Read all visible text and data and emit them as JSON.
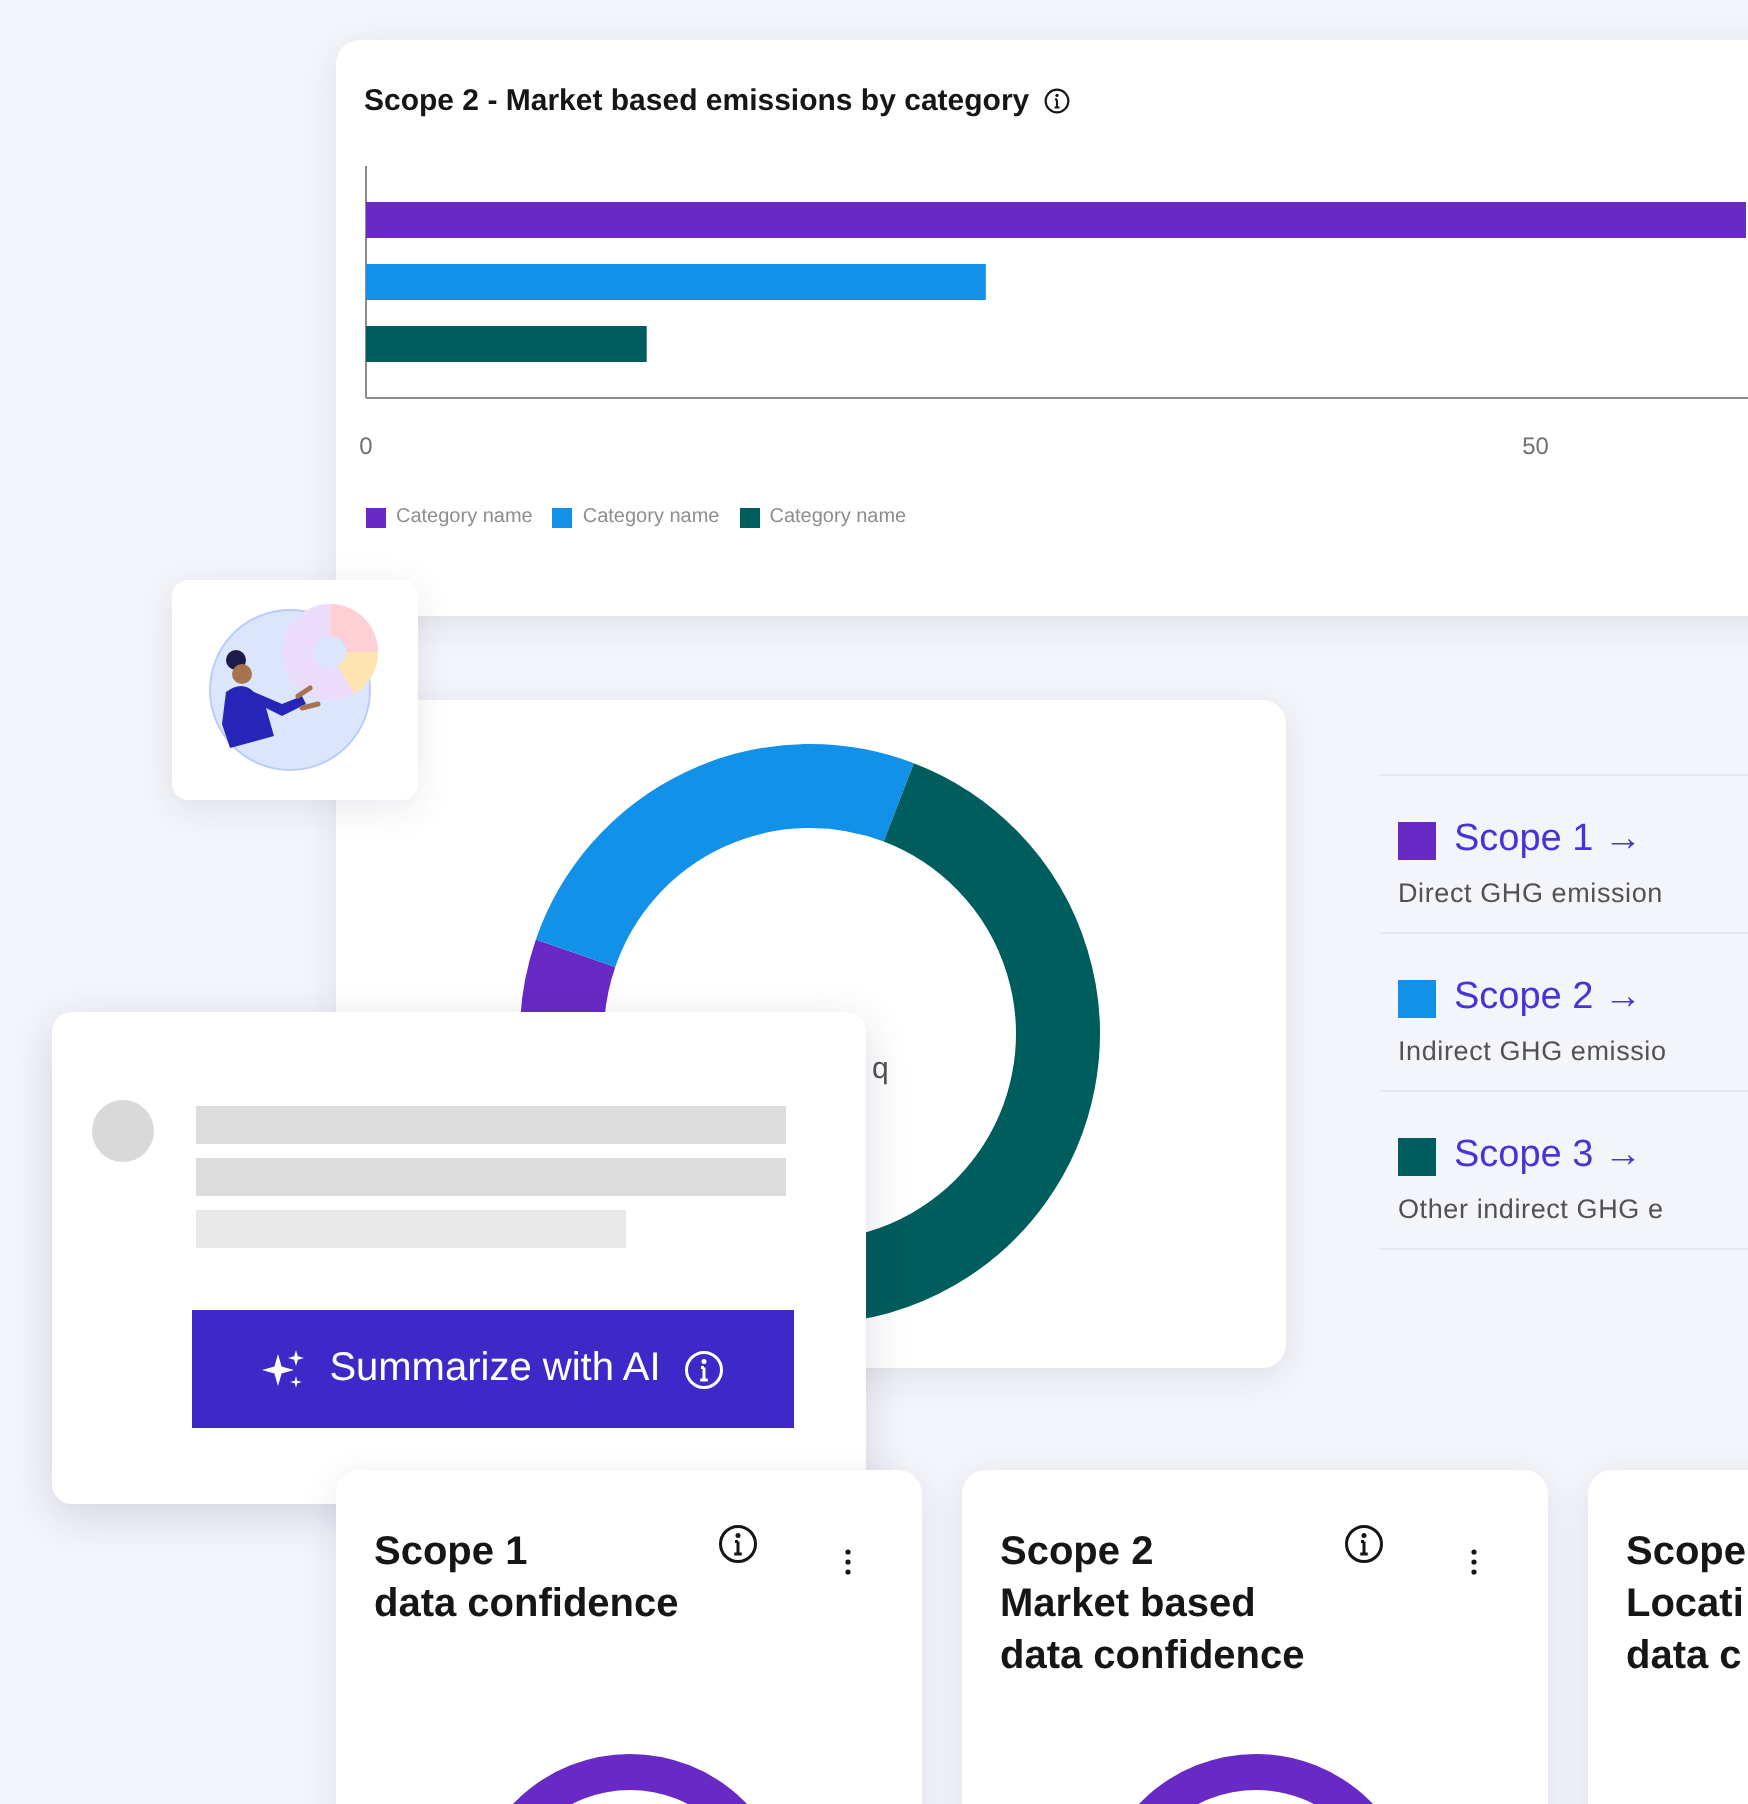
{
  "bar_chart_card": {
    "title": "Scope 2 - Market based emissions by category",
    "chart_data": {
      "type": "bar",
      "orientation": "horizontal",
      "series": [
        {
          "name": "Category name",
          "color": "#6929c4",
          "values": [
            59
          ]
        },
        {
          "name": "Category name",
          "color": "#1192e8",
          "values": [
            26.5
          ]
        },
        {
          "name": "Category name",
          "color": "#005d5d",
          "values": [
            12
          ]
        }
      ],
      "xlim": [
        0,
        59
      ],
      "xticks": [
        0,
        50
      ]
    }
  },
  "scope_summary": {
    "center_unit": "q",
    "scopes": [
      {
        "label": "Scope 1 →",
        "description": "Direct GHG emission",
        "color": "#6929c4"
      },
      {
        "label": "Scope 2 →",
        "description": "Indirect GHG emissio",
        "color": "#1192e8"
      },
      {
        "label": "Scope 3 →",
        "description": "Other indirect GHG e",
        "color": "#005d5d"
      }
    ]
  },
  "ai_card": {
    "button": "Summarize with AI"
  },
  "confidence_cards": [
    {
      "title_lines": [
        "Scope 1",
        "data confidence"
      ],
      "info_icon": true,
      "menu_icon": true,
      "gauge": true
    },
    {
      "title_lines": [
        "Scope 2",
        "Market based",
        "data confidence"
      ],
      "info_icon": true,
      "menu_icon": true,
      "gauge": true
    },
    {
      "title_lines": [
        "Scope",
        "Locati",
        "data c"
      ],
      "info_icon": false,
      "menu_icon": false,
      "gauge": false
    }
  ]
}
